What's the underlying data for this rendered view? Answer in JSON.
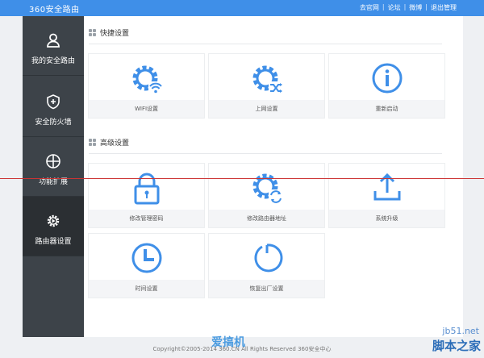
{
  "header": {
    "logo": "360安全路由",
    "links": [
      "去官网",
      "论坛",
      "微博",
      "退出管理"
    ],
    "separator": "|"
  },
  "sidebar": {
    "items": [
      {
        "label": "我的安全路由",
        "icon": "user-icon"
      },
      {
        "label": "安全防火墙",
        "icon": "shield-plus-icon"
      },
      {
        "label": "功能扩展",
        "icon": "expand-grid-icon"
      },
      {
        "label": "路由器设置",
        "icon": "gear-icon"
      }
    ],
    "active_index": 3
  },
  "quick": {
    "title": "快捷设置",
    "cards": [
      {
        "label": "WIFI设置",
        "icon": "gear-wifi-icon"
      },
      {
        "label": "上网设置",
        "icon": "gear-shuffle-icon"
      },
      {
        "label": "重新启动",
        "icon": "info-icon"
      }
    ]
  },
  "advanced": {
    "title": "高级设置",
    "cards": [
      {
        "label": "修改管理密码",
        "icon": "lock-icon"
      },
      {
        "label": "修改路由器地址",
        "icon": "gear-refresh-icon"
      },
      {
        "label": "系统升级",
        "icon": "upload-icon"
      },
      {
        "label": "时间设置",
        "icon": "clock-icon"
      },
      {
        "label": "恢复出厂设置",
        "icon": "restore-icon"
      }
    ]
  },
  "footer": {
    "copyright": "Copyright©2005-2014 360.CN All Rights Reserved 360安全中心",
    "watermark": "爱搞机",
    "site": "jb51.net",
    "site_name": "脚本之家"
  },
  "colors": {
    "accent": "#3f8fe8",
    "icon": "#3f8fe8",
    "sidebar": "#3d4349"
  }
}
